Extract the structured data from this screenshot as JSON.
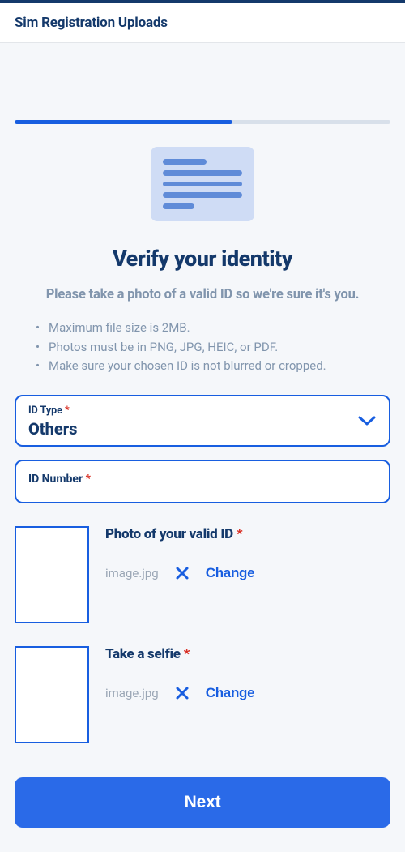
{
  "header": {
    "title": "Sim Registration Uploads"
  },
  "hero": {
    "title": "Verify your identity",
    "subtitle": "Please take a photo of a valid ID so we're sure it's you."
  },
  "rules": [
    "Maximum file size is 2MB.",
    "Photos must be in PNG, JPG, HEIC, or PDF.",
    "Make sure your chosen ID is not blurred or cropped."
  ],
  "fields": {
    "id_type": {
      "label": "ID Type",
      "value": "Others"
    },
    "id_number": {
      "label": "ID Number"
    }
  },
  "uploads": {
    "valid_id": {
      "title": "Photo of your valid ID",
      "filename": "image.jpg",
      "change_label": "Change"
    },
    "selfie": {
      "title": "Take a selfie",
      "filename": "image.jpg",
      "change_label": "Change"
    }
  },
  "actions": {
    "next": "Next"
  }
}
